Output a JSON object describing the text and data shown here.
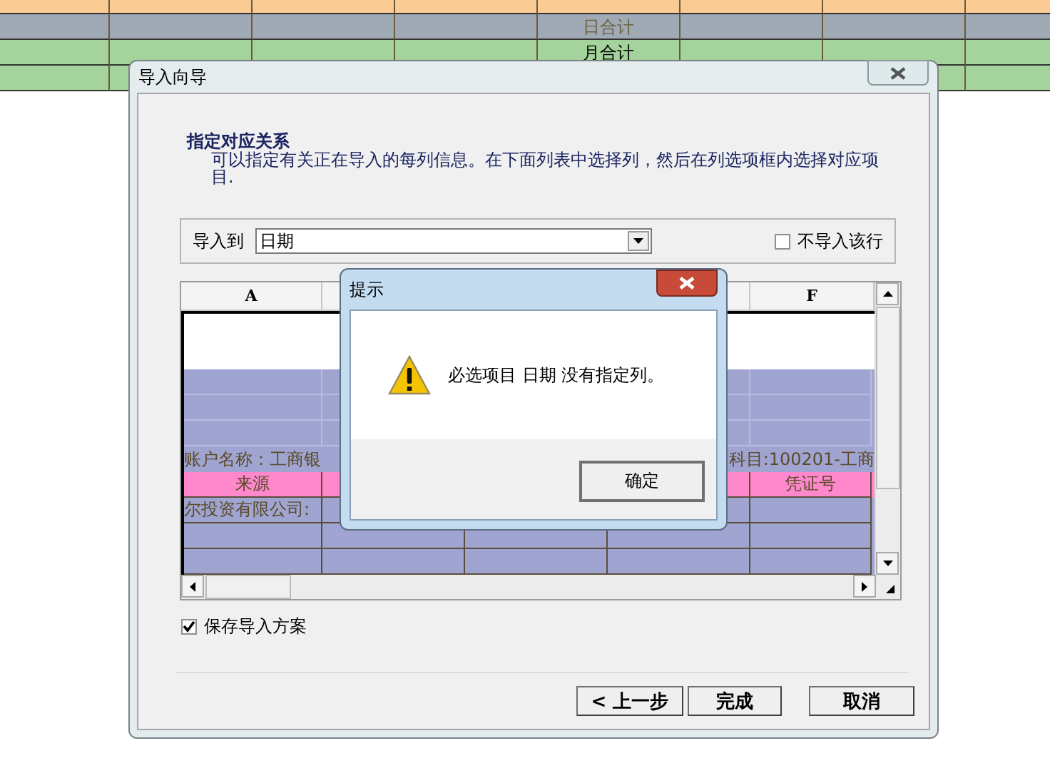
{
  "sheet": {
    "rows": [
      {
        "kind": "opening"
      },
      {
        "kind": "daily",
        "label": "日合计"
      },
      {
        "kind": "monthly",
        "label": "月合计"
      },
      {
        "kind": "monthly"
      }
    ]
  },
  "wizard": {
    "title": "导入向导",
    "heading": "指定对应关系",
    "description": "可以指定有关正在导入的每列信息。在下面列表中选择列，然后在列选项框内选择对应项目.",
    "import_to": {
      "label": "导入到",
      "value": "日期"
    },
    "skip_row": {
      "label": "不导入该行",
      "checked": false
    },
    "grid": {
      "first_column": "A",
      "last_column": "F",
      "rows": [
        {
          "kind": "blank"
        },
        {
          "kind": "shaded"
        },
        {
          "kind": "shaded"
        },
        {
          "kind": "shaded"
        },
        {
          "kind": "caption",
          "left": "账户名称：工商银",
          "right": "科目:100201-工商"
        },
        {
          "kind": "header",
          "first": "来源",
          "last": "凭证号"
        },
        {
          "kind": "shaded",
          "first": "尔投资有限公司:"
        },
        {
          "kind": "shaded"
        },
        {
          "kind": "shaded"
        }
      ]
    },
    "save_scheme": {
      "label": "保存导入方案",
      "checked": true
    },
    "buttons": [
      "< 上一步",
      "完成",
      "取消"
    ]
  },
  "message": {
    "title": "提示",
    "text": "必选项目 日期 没有指定列。",
    "button": "确定"
  }
}
